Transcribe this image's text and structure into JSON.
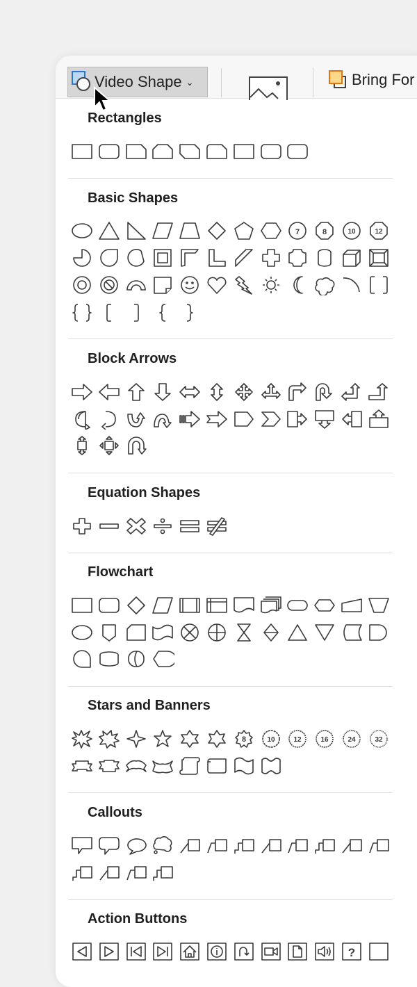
{
  "toolbar": {
    "video_shape_label": "Video Shape",
    "picture_icon": "picture-icon",
    "bring_forward_label": "Bring For",
    "accent_blue": "#5b9bd5",
    "accent_orange": "#e8730c"
  },
  "sections": [
    {
      "title": "Rectangles",
      "rows": [
        [
          "rect",
          "roundrect",
          "snip1",
          "snip2same",
          "snipdiag",
          "sniproundsame",
          "rect",
          "roundrect",
          "roundrect"
        ]
      ]
    },
    {
      "title": "Basic Shapes",
      "rows": [
        [
          "oval",
          "triangle",
          "rtriangle",
          "parallelogram",
          "trapezoid",
          "diamond",
          "pentagon",
          "hexagon",
          "oct7",
          "oct8",
          "oct10",
          "oct12"
        ],
        [
          "pie",
          "teardrop",
          "chord",
          "frame",
          "halfframe",
          "lshape",
          "diagstripe",
          "cross",
          "plaque",
          "can",
          "cube",
          "bevel"
        ],
        [
          "donut",
          "nosymbol",
          "blockarc",
          "foldedcorner",
          "smiley",
          "heart",
          "lightning",
          "sun",
          "moon",
          "cloud",
          "arc",
          "bracketpair"
        ],
        [
          "bracepair",
          "leftbracket",
          "rightbracket",
          "leftbrace",
          "rightbrace"
        ]
      ]
    },
    {
      "title": "Block Arrows",
      "rows": [
        [
          "arrowright",
          "arrowleft",
          "arrowup",
          "arrowdown",
          "arrowlr",
          "arrowud",
          "quadarrow",
          "lrupArrow",
          "bentarrow",
          "uturn",
          "leftuparrow",
          "bentup"
        ],
        [
          "curvedright",
          "curvedleft",
          "curvedup",
          "curveddown",
          "stripedright",
          "notchedright",
          "pentagonarrow",
          "chevron",
          "calloutright",
          "calloutdown",
          "calloutleft",
          "calloutup"
        ],
        [
          "calloutud",
          "calloutquad",
          "circulararrow"
        ]
      ]
    },
    {
      "title": "Equation Shapes",
      "rows": [
        [
          "plus",
          "minus",
          "multiply",
          "divide",
          "equal",
          "notequal"
        ]
      ]
    },
    {
      "title": "Flowchart",
      "rows": [
        [
          "rect",
          "roundrect",
          "diamond",
          "parallelogram",
          "predefined",
          "internalstorage",
          "document",
          "multidoc",
          "terminator",
          "preparation",
          "manualinput",
          "manualop"
        ],
        [
          "oval",
          "offpage",
          "card",
          "tape",
          "summing",
          "or",
          "collate",
          "sort",
          "extract",
          "merge",
          "storeddata",
          "delay"
        ],
        [
          "sequential",
          "magneticdisk",
          "directaccess",
          "display"
        ]
      ]
    },
    {
      "title": "Stars and Banners",
      "rows": [
        [
          "explosion1",
          "explosion2",
          "star4",
          "star5",
          "star6",
          "star7",
          "star8",
          "star10",
          "star12",
          "star16",
          "star24",
          "star32"
        ],
        [
          "ribbonup",
          "ribbondown",
          "curvedribbonup",
          "curvedribbondown",
          "scrollv",
          "scrollh",
          "wave",
          "doublewave"
        ]
      ]
    },
    {
      "title": "Callouts",
      "rows": [
        [
          "callrect",
          "callround",
          "calloval",
          "callcloud",
          "line1",
          "line2",
          "line3",
          "line1",
          "line2",
          "line3",
          "line1",
          "line2"
        ],
        [
          "line3",
          "line1",
          "line2",
          "line3"
        ]
      ]
    },
    {
      "title": "Action Buttons",
      "rows": [
        [
          "abback",
          "abforward",
          "abbegin",
          "abend",
          "abhome",
          "abinfo",
          "abreturn",
          "abmovie",
          "abdocument",
          "absound",
          "abhelp",
          "abblank"
        ]
      ]
    }
  ]
}
